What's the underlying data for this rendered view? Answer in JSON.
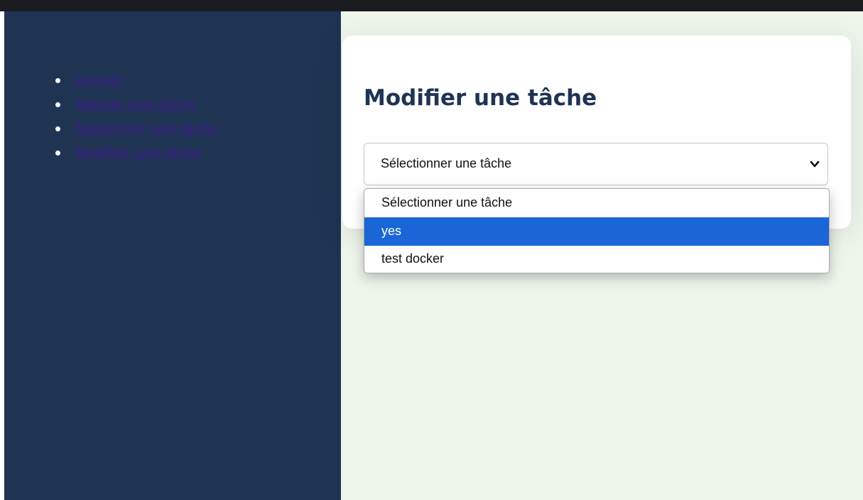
{
  "nav": {
    "items": [
      {
        "label": "Accueil"
      },
      {
        "label": "Ajouter une tâche"
      },
      {
        "label": "Supprimer une tâche"
      },
      {
        "label": "Modifier une tâche"
      }
    ]
  },
  "main": {
    "title": "Modifier une tâche",
    "select": {
      "selected": "Sélectionner une tâche",
      "options": [
        {
          "label": "Sélectionner une tâche",
          "highlighted": false
        },
        {
          "label": "yes",
          "highlighted": true
        },
        {
          "label": "test docker",
          "highlighted": false
        }
      ]
    }
  },
  "colors": {
    "sidebar": "#1f3453",
    "main_bg": "#eef6ec",
    "title": "#1f3453",
    "link": "#3d1a8a",
    "highlight": "#1a66d6"
  }
}
